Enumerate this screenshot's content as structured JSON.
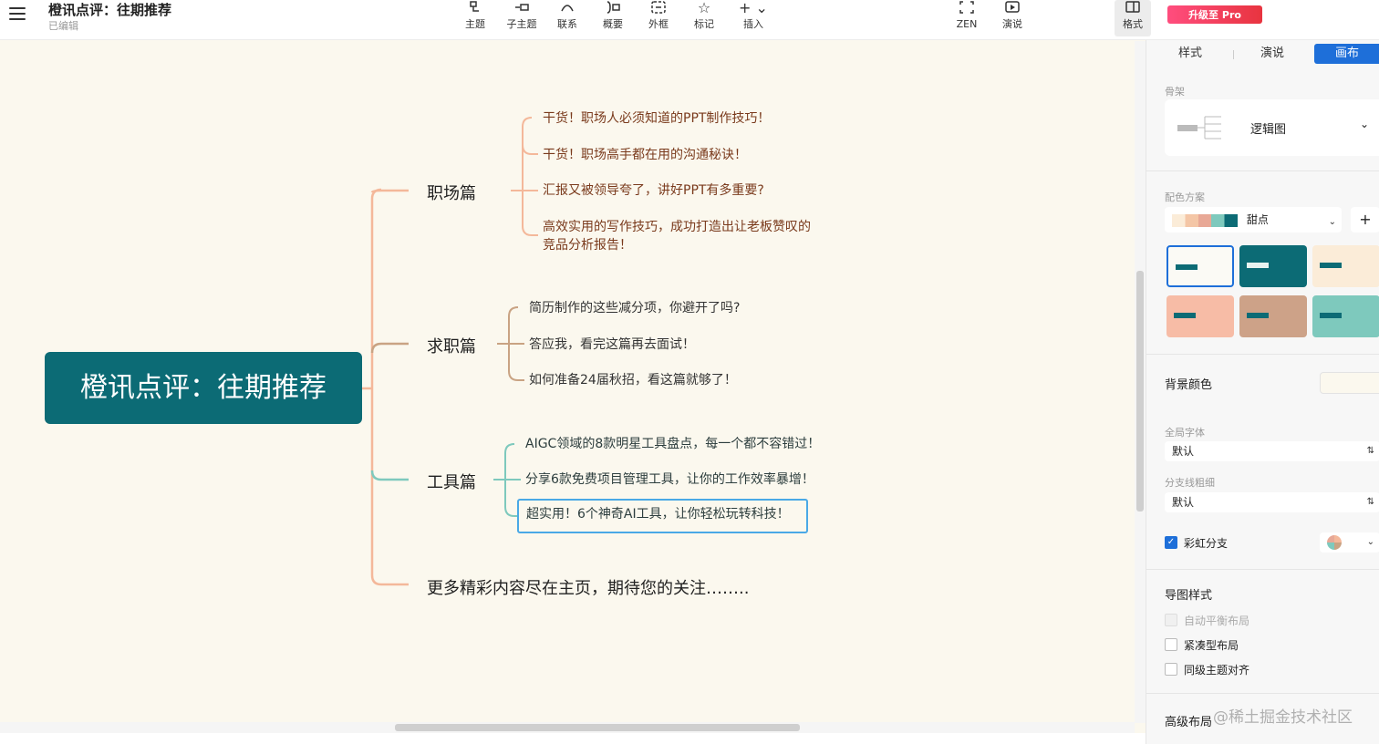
{
  "header": {
    "title": "橙讯点评：往期推荐",
    "status": "已编辑",
    "upgrade_label": "升级至 Pro"
  },
  "toolbar": {
    "topic": "主题",
    "subtopic": "子主题",
    "relation": "联系",
    "summary": "概要",
    "boundary": "外框",
    "marker": "标记",
    "insert": "插入",
    "zen": "ZEN",
    "present": "演说",
    "format": "格式"
  },
  "mindmap": {
    "root": "橙讯点评：往期推荐",
    "branches": [
      {
        "label": "职场篇",
        "color": "#f4b89a",
        "leaves": [
          "干货！职场人必须知道的PPT制作技巧！",
          "干货！职场高手都在用的沟通秘诀！",
          "汇报又被领导夸了，讲好PPT有多重要?",
          "高效实用的写作技巧，成功打造出让老板赞叹的",
          "竞品分析报告！"
        ]
      },
      {
        "label": "求职篇",
        "color": "#c9a383",
        "leaves": [
          "简历制作的这些减分项，你避开了吗?",
          "答应我，看完这篇再去面试！",
          "如何准备24届秋招，看这篇就够了！"
        ]
      },
      {
        "label": "工具篇",
        "color": "#7ec9bd",
        "leaves": [
          "AIGC领域的8款明星工具盘点，每一个都不容错过！",
          "分享6款免费项目管理工具，让你的工作效率暴增！",
          "超实用！6个神奇AI工具，让你轻松玩转科技！"
        ]
      },
      {
        "label": "更多精彩内容尽在主页，期待您的关注……..",
        "color": "#f4b89a",
        "leaves": []
      }
    ]
  },
  "panel": {
    "tabs": [
      "样式",
      "演说",
      "画布"
    ],
    "skeleton_label": "骨架",
    "skeleton_value": "逻辑图",
    "color_scheme_label": "配色方案",
    "color_scheme_value": "甜点",
    "bg_color_label": "背景颜色",
    "font_label": "全局字体",
    "font_value": "默认",
    "line_label": "分支线粗细",
    "line_value": "默认",
    "rainbow_label": "彩虹分支",
    "map_style_label": "导图样式",
    "auto_balance": "自动平衡布局",
    "compact": "紧凑型布局",
    "align": "同级主题对齐",
    "advanced_label": "高级布局"
  },
  "watermark": "@稀土掘金技术社区"
}
